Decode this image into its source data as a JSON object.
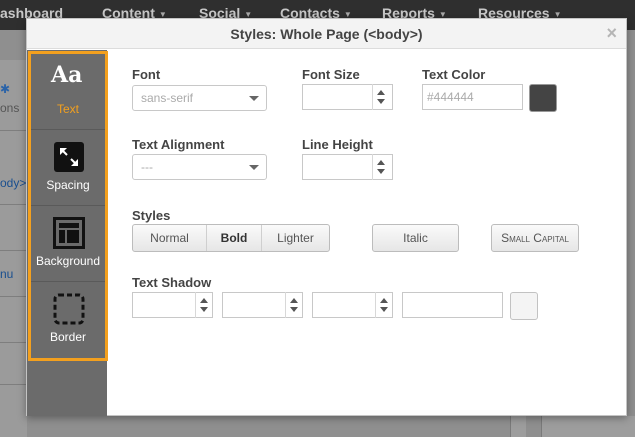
{
  "background": {
    "nav": [
      {
        "label": "ashboard"
      },
      {
        "label": "Content"
      },
      {
        "label": "Social"
      },
      {
        "label": "Contacts"
      },
      {
        "label": "Reports"
      },
      {
        "label": "Resources"
      }
    ],
    "left_texts": {
      "icon_label": "ons",
      "link1": "ody>)",
      "link2": "nu"
    }
  },
  "dialog": {
    "title": "Styles: Whole Page (<body>)",
    "close": "×",
    "tabs": [
      {
        "label": "Text",
        "icon": "text-icon",
        "active": true
      },
      {
        "label": "Spacing",
        "icon": "spacing-icon",
        "active": false
      },
      {
        "label": "Background",
        "icon": "background-icon",
        "active": false
      },
      {
        "label": "Border",
        "icon": "border-icon",
        "active": false
      }
    ],
    "aa_glyph": "Aa",
    "font": {
      "label": "Font",
      "value": "sans-serif"
    },
    "font_size": {
      "label": "Font Size",
      "value": ""
    },
    "text_color": {
      "label": "Text Color",
      "placeholder": "#444444",
      "swatch": "#444444"
    },
    "text_alignment": {
      "label": "Text Alignment",
      "value": "---"
    },
    "line_height": {
      "label": "Line Height",
      "value": ""
    },
    "styles": {
      "label": "Styles",
      "weight_buttons": [
        "Normal",
        "Bold",
        "Lighter"
      ],
      "italic": "Italic",
      "small_caps": "Small Capital"
    },
    "text_shadow": {
      "label": "Text Shadow"
    }
  },
  "colors": {
    "accent": "#f3a01e",
    "sidebar": "#6b6b6b",
    "topbar": "#2f2f2f"
  }
}
